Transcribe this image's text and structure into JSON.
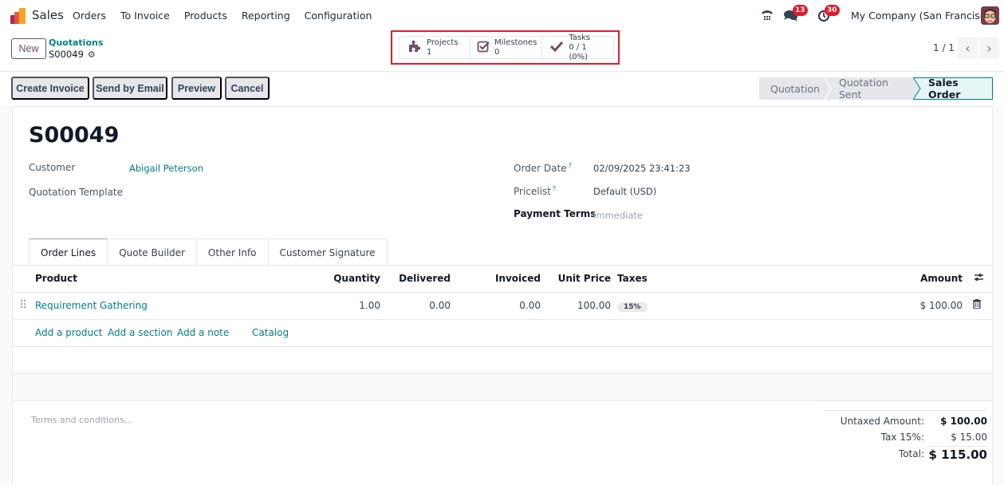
{
  "navbar": {
    "app_name": "Sales",
    "menu": [
      "Orders",
      "To Invoice",
      "Products",
      "Reporting",
      "Configuration"
    ],
    "systray": {
      "phone_icon": "phone-icon",
      "messages_icon": "chat-icon",
      "messages_count": "13",
      "activities_icon": "clock-icon",
      "activities_count": "30",
      "company": "My Company (San Francisco)",
      "avatar_icon": "user-avatar"
    },
    "colors": {
      "badge": "#e5182d"
    }
  },
  "control_panel": {
    "new_button": "New",
    "breadcrumb_parent": "Quotations",
    "record_name": "S00049",
    "gear_icon": "gear-icon",
    "smart_buttons": [
      {
        "icon": "puzzle-icon",
        "label": "Projects",
        "value": "1"
      },
      {
        "icon": "checkbox-icon",
        "label": "Milestones",
        "value": "0"
      },
      {
        "icon": "check-icon",
        "label": "Tasks",
        "value": "0 / 1 (0%)"
      }
    ],
    "pager": "1 / 1",
    "pager_prev_icon": "chevron-left-icon",
    "pager_next_icon": "chevron-right-icon"
  },
  "action_bar": {
    "buttons": [
      "Create Invoice",
      "Send by Email",
      "Preview",
      "Cancel"
    ],
    "status_steps": [
      "Quotation",
      "Quotation Sent",
      "Sales Order"
    ],
    "active_status": "Sales Order"
  },
  "form": {
    "title": "S00049",
    "left_fields": [
      {
        "label": "Customer",
        "value": "Abigail Peterson"
      },
      {
        "label": "Quotation Template",
        "value": ""
      }
    ],
    "right_fields": [
      {
        "label": "Order Date",
        "help": "?",
        "value": "02/09/2025 23:41:23"
      },
      {
        "label": "Pricelist",
        "help": "?",
        "value": "Default (USD)"
      },
      {
        "label": "Payment Terms",
        "value": "Immediate"
      }
    ],
    "tabs": [
      "Order Lines",
      "Quote Builder",
      "Other Info",
      "Customer Signature"
    ],
    "active_tab": "Order Lines",
    "table": {
      "columns": [
        "Product",
        "Quantity",
        "Delivered",
        "Invoiced",
        "Unit Price",
        "Taxes",
        "Amount"
      ],
      "rows": [
        {
          "product": "Requirement Gathering",
          "quantity": "1.00",
          "delivered": "0.00",
          "invoiced": "0.00",
          "unit_price": "100.00",
          "taxes": "15%",
          "amount": "$ 100.00"
        }
      ],
      "add_links": [
        "Add a product",
        "Add a section",
        "Add a note",
        "Catalog"
      ]
    },
    "terms_placeholder": "Terms and conditions...",
    "totals": {
      "untaxed_label": "Untaxed Amount:",
      "untaxed_value": "$ 100.00",
      "tax_label": "Tax 15%:",
      "tax_value": "$ 15.00",
      "total_label": "Total:",
      "total_value": "$ 115.00"
    }
  },
  "colors": {
    "primary": "#714b67",
    "link": "#017e84",
    "highlight_box": "#e11d2a"
  }
}
